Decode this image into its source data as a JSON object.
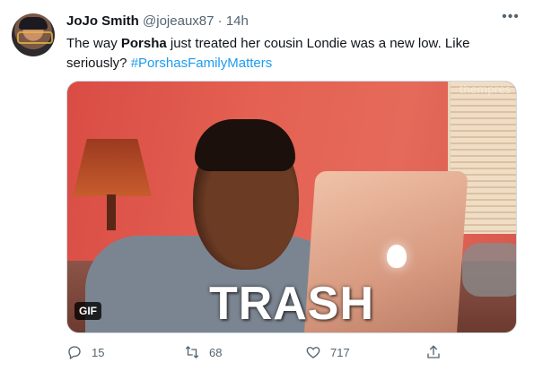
{
  "tweet": {
    "author_name": "JoJo Smith",
    "handle": "@jojeaux87",
    "separator": "·",
    "time": "14h",
    "more_label": "•••",
    "text_prefix": "The way ",
    "text_bold": "Porsha",
    "text_middle": " just treated her cousin Londie was a new low. Like seriously? ",
    "hashtag": "#PorshasFamilyMatters"
  },
  "media": {
    "caption": "TRASH",
    "badge": "GIF",
    "watermark": "thempres"
  },
  "actions": {
    "reply_count": "15",
    "retweet_count": "68",
    "like_count": "717"
  },
  "icons": {
    "reply": "reply-icon",
    "retweet": "retweet-icon",
    "like": "heart-icon",
    "share": "share-icon"
  },
  "colors": {
    "link": "#1d9bf0",
    "secondary_text": "#536471"
  }
}
